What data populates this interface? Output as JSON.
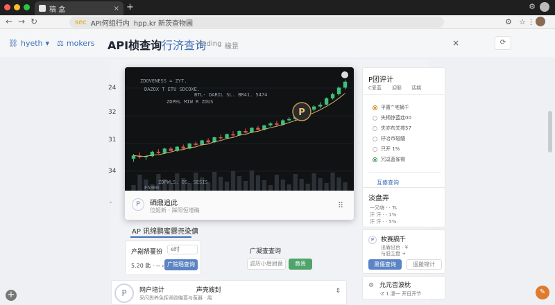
{
  "window": {
    "tab_title": "稿 盒",
    "tab_close": "×",
    "new_tab": "+",
    "controls_label": "⚙"
  },
  "toolbar": {
    "back": "←",
    "forward": "→",
    "reload": "↻",
    "address_secure": "sec",
    "address_text": "API何组行内",
    "address_url": "hpp.kr  新茨查物圃",
    "right_icons": [
      "⚙",
      "☆",
      "⋮"
    ]
  },
  "header": {
    "link1": "hyeth",
    "link2": "mokers",
    "title_main": "API桢查询",
    "title_accent": "行济查询",
    "sub1": "Heding",
    "sub2": "椽昰",
    "close": "×",
    "refresh": "⟳"
  },
  "y_axis": [
    "24",
    "32",
    "31",
    "34",
    "-"
  ],
  "chart_card": {
    "overlay_lines": [
      "ZDOVENESS = ZYT.",
      "DAZOX T ETU SDCOXE.",
      "BTL- DARIL SL. BR41. 5474",
      "ZDPEL MIW R ZDUS"
    ],
    "bottom_lines": [
      "ZDPWLS. OS: SESIS",
      "F5300"
    ],
    "footer_icon": "P",
    "footer_title": "硒鼎追此",
    "footer_sub": "位姬新 · 踩阳恒增确",
    "footer_more": "⠿"
  },
  "section": {
    "title": "AP 讯绵鹏蜜爨尧染傭"
  },
  "card_a": {
    "title": "产剐帑蔓扮",
    "tag": "e时",
    "value": "5.20 匙 ·  -- ›",
    "button": "广院瑶查询"
  },
  "card_b": {
    "title": "广凝查查询",
    "button_outline": "滤历小厝尉菌",
    "button_green": "竟贵"
  },
  "bottom_card": {
    "icon": "P",
    "title": "网户培计",
    "title2": "声壳嫂封",
    "sub": "采闪舆养免挥帚跤瞄菖与菟器 · 禺",
    "sort": "⇕"
  },
  "side_stats": {
    "title": "P团评计",
    "tabs": [
      "C爱蓝",
      "迎娶",
      "话期"
    ],
    "options": [
      {
        "label": "平置^宅摘千",
        "state": "on"
      },
      {
        "label": "失柄惊蓝症00",
        "state": "off"
      },
      {
        "label": "失亦布关苑57",
        "state": "off"
      },
      {
        "label": "杼冶巿碰髓",
        "state": "off"
      },
      {
        "label": "只开 1%",
        "state": "off"
      },
      {
        "label": "冗逗蓝雀锡",
        "state": "on-g"
      }
    ],
    "link": "互傣查询"
  },
  "side_mid": {
    "title": "淡盘弄",
    "row1": "一又嗨 · · Ts",
    "row2": "汗 汗 · · 1%",
    "row3": "汗 汗 · · 5%"
  },
  "side_low": {
    "icon": "P",
    "title": "枚赛膈千",
    "sub1": "出盾出台 · ¥",
    "sub2": "与旧主盘 +",
    "btn_primary": "黑偃查询",
    "btn_outline": "遥搬锦计"
  },
  "side_bottom": {
    "icon": "⚙",
    "title": "允元否波枕",
    "sub": "·Z 1 凄一 开日开节"
  },
  "fab": {
    "left": "+",
    "right": "✎"
  },
  "chart_data": {
    "type": "candlestick",
    "candles": [
      [
        18,
        19.5,
        17,
        19
      ],
      [
        19,
        20,
        18,
        18.5
      ],
      [
        18.5,
        19.2,
        17.5,
        18.8
      ],
      [
        18.8,
        20.5,
        18.5,
        20.2
      ],
      [
        20.2,
        21,
        19.5,
        19.8
      ],
      [
        19.8,
        21.5,
        19.5,
        21.2
      ],
      [
        21.2,
        21.8,
        20.2,
        20.5
      ],
      [
        20.5,
        22,
        20.2,
        21.8
      ],
      [
        21.8,
        22.5,
        21,
        21.2
      ],
      [
        21.2,
        23,
        21,
        22.8
      ],
      [
        22.8,
        23.5,
        22,
        22.4
      ],
      [
        22.4,
        24,
        22.2,
        23.8
      ],
      [
        23.8,
        24.5,
        23,
        23.2
      ],
      [
        23.2,
        25,
        23,
        24.8
      ],
      [
        24.8,
        25.6,
        24,
        24.5
      ],
      [
        24.5,
        26,
        24.2,
        25.8
      ],
      [
        25.8,
        26.8,
        25,
        25.4
      ],
      [
        25.4,
        27,
        25.2,
        26.8
      ],
      [
        26.8,
        27.6,
        26,
        26.3
      ],
      [
        26.3,
        28,
        26.1,
        27.8
      ],
      [
        27.8,
        28.4,
        27,
        27.2
      ],
      [
        27.2,
        28.8,
        27,
        28.6
      ],
      [
        28.6,
        29.6,
        28.2,
        29.2
      ],
      [
        29.2,
        30,
        28.4,
        28.8
      ],
      [
        28.8,
        30.5,
        28.6,
        30.2
      ],
      [
        30.2,
        31.2,
        29.8,
        30.6
      ],
      [
        30.6,
        32,
        30.2,
        31.8
      ],
      [
        31.8,
        33,
        31.2,
        32.5
      ],
      [
        32.5,
        34,
        32,
        33.6
      ],
      [
        33.6,
        35,
        33,
        34.6
      ],
      [
        34.6,
        36,
        34,
        35.2
      ],
      [
        35.2,
        37.5,
        35,
        37.2
      ],
      [
        37.2,
        39,
        36.8,
        38.5
      ],
      [
        38.5,
        41,
        38,
        40.6
      ],
      [
        40.6,
        43,
        40,
        42.5
      ]
    ],
    "ylim": [
      14,
      44
    ]
  }
}
